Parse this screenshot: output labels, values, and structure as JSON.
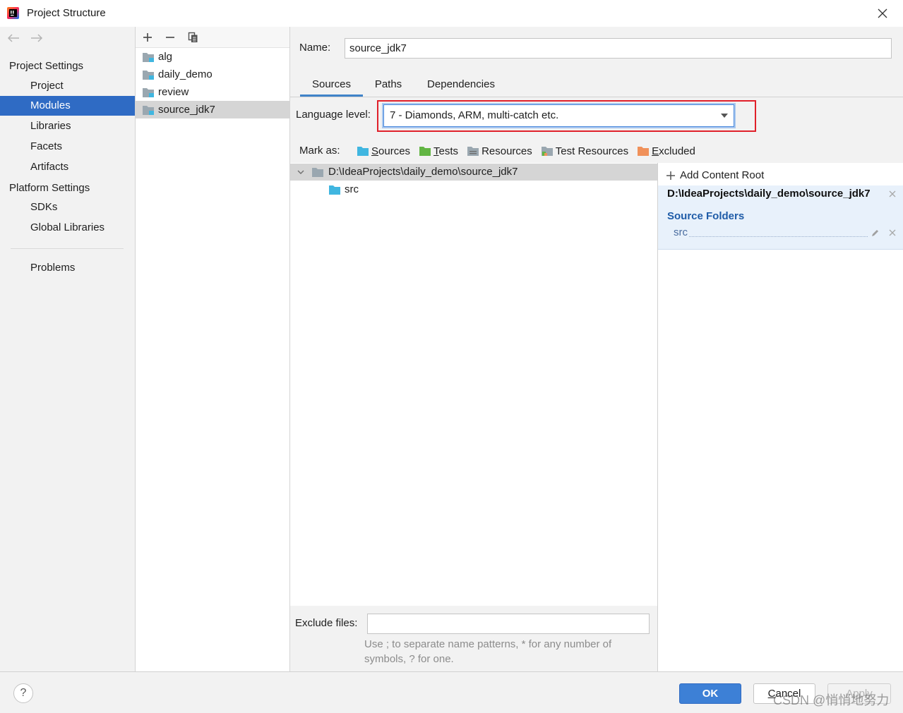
{
  "window": {
    "title": "Project Structure"
  },
  "sidebar": {
    "project_settings": {
      "title": "Project Settings",
      "items": [
        "Project",
        "Modules",
        "Libraries",
        "Facets",
        "Artifacts"
      ]
    },
    "platform_settings": {
      "title": "Platform Settings",
      "items": [
        "SDKs",
        "Global Libraries"
      ]
    },
    "problems": "Problems",
    "selected_index": 1
  },
  "modules": [
    {
      "name": "alg",
      "selected": false
    },
    {
      "name": "daily_demo",
      "selected": false
    },
    {
      "name": "review",
      "selected": false
    },
    {
      "name": "source_jdk7",
      "selected": true
    }
  ],
  "module_editor": {
    "name_label": "Name:",
    "name_value": "source_jdk7",
    "tabs": [
      {
        "label": "Sources",
        "active": true
      },
      {
        "label": "Paths",
        "active": false
      },
      {
        "label": "Dependencies",
        "active": false
      }
    ],
    "language_level": {
      "label": "Language level:",
      "value": "7 - Diamonds, ARM, multi-catch etc."
    },
    "mark_as": {
      "label": "Mark as:",
      "options": [
        {
          "label": "Sources",
          "icon": "source-folder-icon"
        },
        {
          "label": "Tests",
          "icon": "test-folder-icon"
        },
        {
          "label": "Resources",
          "icon": "resources-folder-icon"
        },
        {
          "label": "Test Resources",
          "icon": "test-resources-folder-icon"
        },
        {
          "label": "Excluded",
          "icon": "excluded-folder-icon"
        }
      ]
    },
    "tree": {
      "root": {
        "path": "D:\\IdeaProjects\\daily_demo\\source_jdk7",
        "icon": "folder-icon",
        "expanded": true,
        "selected": true
      },
      "children": [
        {
          "name": "src",
          "icon": "source-folder-icon"
        }
      ]
    },
    "exclude_files": {
      "label": "Exclude files:",
      "value": "",
      "hint_lines": [
        "Use ; to separate name patterns, * for any number of",
        "symbols, ? for one."
      ]
    }
  },
  "content_root_panel": {
    "add_label": "Add Content Root",
    "root_path": "D:\\IdeaProjects\\daily_demo\\source_jdk7",
    "source_folders_title": "Source Folders",
    "source_folders": [
      "src"
    ]
  },
  "footer": {
    "help": "?",
    "ok": "OK",
    "cancel": "Cancel",
    "apply": "Apply",
    "apply_enabled": false
  },
  "watermark": "CSDN @悄悄地努力",
  "colors": {
    "selection": "#2f6bc4",
    "inactive_selection": "#d5d5d5",
    "focus": "#4a89dc",
    "tab_underline": "#4083c9",
    "source_folder": "#40b6e0",
    "test_folder": "#62b543",
    "excluded_folder": "#f0915a",
    "module_folder": "#9aa7b0",
    "content_root_bg": "#e8f1fb",
    "source_folders_title": "#1f5ca8",
    "ok_button": "#3d80d6",
    "annotation_red": "#e0202a"
  }
}
